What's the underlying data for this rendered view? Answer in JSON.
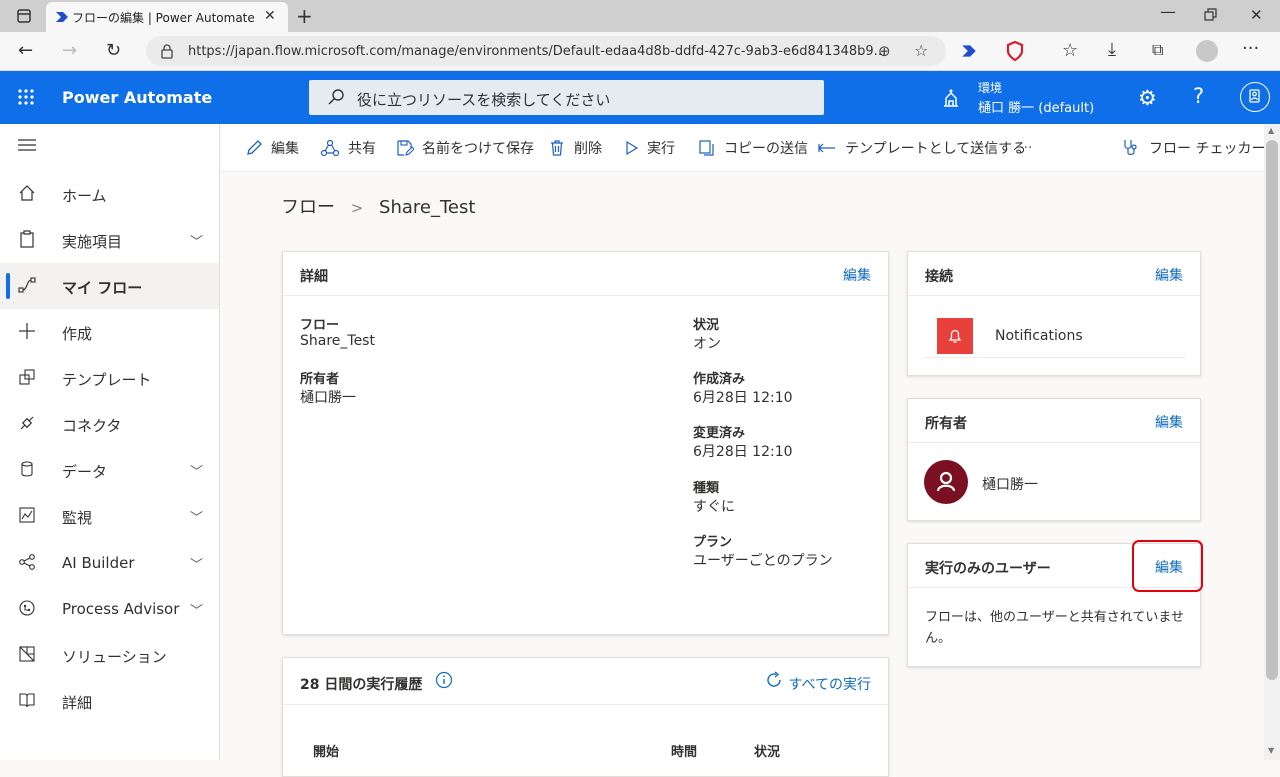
{
  "browser": {
    "tab_title": "フローの編集 | Power Automate",
    "url": "https://japan.flow.microsoft.com/manage/environments/Default-edaa4d8b-ddfd-427c-9ab3-e6d841348b9..."
  },
  "app": {
    "brand": "Power Automate",
    "search_placeholder": "役に立つリソースを検索してください",
    "env_label": "環境",
    "env_name": "樋口 勝一 (default)"
  },
  "sidebar": {
    "items": [
      {
        "label": "ホーム",
        "icon": "home-icon"
      },
      {
        "label": "実施項目",
        "icon": "clipboard-icon",
        "chevron": true
      },
      {
        "label": "マイ フロー",
        "icon": "flow-icon",
        "active": true
      },
      {
        "label": "作成",
        "icon": "plus-icon"
      },
      {
        "label": "テンプレート",
        "icon": "template-icon"
      },
      {
        "label": "コネクタ",
        "icon": "connector-icon"
      },
      {
        "label": "データ",
        "icon": "database-icon",
        "chevron": true
      },
      {
        "label": "監視",
        "icon": "monitor-icon",
        "chevron": true
      },
      {
        "label": "AI Builder",
        "icon": "ai-builder-icon",
        "chevron": true
      },
      {
        "label": "Process Advisor",
        "icon": "process-advisor-icon",
        "chevron": true
      },
      {
        "label": "ソリューション",
        "icon": "solution-icon"
      },
      {
        "label": "詳細",
        "icon": "book-icon"
      }
    ]
  },
  "commands": {
    "edit": "編集",
    "share": "共有",
    "save_as": "名前をつけて保存",
    "delete": "削除",
    "run": "実行",
    "send_copy": "コピーの送信",
    "send_template": "テンプレートとして送信する",
    "more": "···",
    "flow_checker": "フロー チェッカー"
  },
  "breadcrumb": {
    "root": "フロー",
    "sep": ">",
    "current": "Share_Test"
  },
  "details": {
    "title": "詳細",
    "edit": "編集",
    "flow_label": "フロー",
    "flow_value": "Share_Test",
    "owner_label": "所有者",
    "owner_value": "樋口勝一",
    "status_label": "状況",
    "status_value": "オン",
    "created_label": "作成済み",
    "created_value": "6月28日 12:10",
    "modified_label": "変更済み",
    "modified_value": "6月28日 12:10",
    "type_label": "種類",
    "type_value": "すぐに",
    "plan_label": "プラン",
    "plan_value": "ユーザーごとのプラン"
  },
  "history": {
    "title": "28 日間の実行履歴",
    "all_runs": "すべての実行",
    "col_start": "開始",
    "col_duration": "時間",
    "col_status": "状況"
  },
  "connections": {
    "title": "接続",
    "edit": "編集",
    "item": "Notifications",
    "item_color": "#e8403a"
  },
  "owners": {
    "title": "所有者",
    "edit": "編集",
    "name": "樋口勝一",
    "avatar_color": "#7a1021"
  },
  "run_only": {
    "title": "実行のみのユーザー",
    "edit": "編集",
    "message": "フローは、他のユーザーと共有されていません。",
    "highlight_color": "#e3000f"
  },
  "colors": {
    "accent": "#0f6fe8",
    "link": "#0f6cbd"
  }
}
